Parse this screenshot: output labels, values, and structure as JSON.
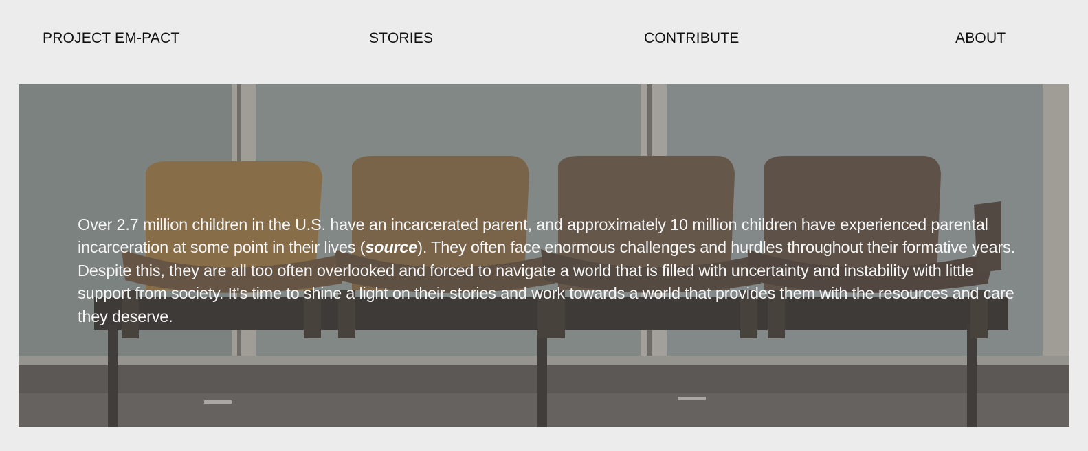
{
  "nav": {
    "brand": "PROJECT EM-PACT",
    "stories": "STORIES",
    "contribute": "CONTRIBUTE",
    "about": "ABOUT"
  },
  "hero": {
    "text_before": "Over 2.7 million children in the U.S. have an incarcerated parent, and approximately 10 million children have experienced parental incarceration at some point in their lives (",
    "source_link": "source",
    "text_after": "). They often face enormous challenges and hurdles throughout their formative years. Despite this, they are all too often overlooked and forced to navigate a world that is filled with uncertainty and instability with little support from society. It's time to shine a light on their stories and work towards a world that provides them with the resources and care they deserve.",
    "background_image": "four-wooden-waiting-room-chairs"
  },
  "colors": {
    "page_background": "#ececec",
    "nav_text": "#111111",
    "hero_text": "#f6f6f6"
  }
}
